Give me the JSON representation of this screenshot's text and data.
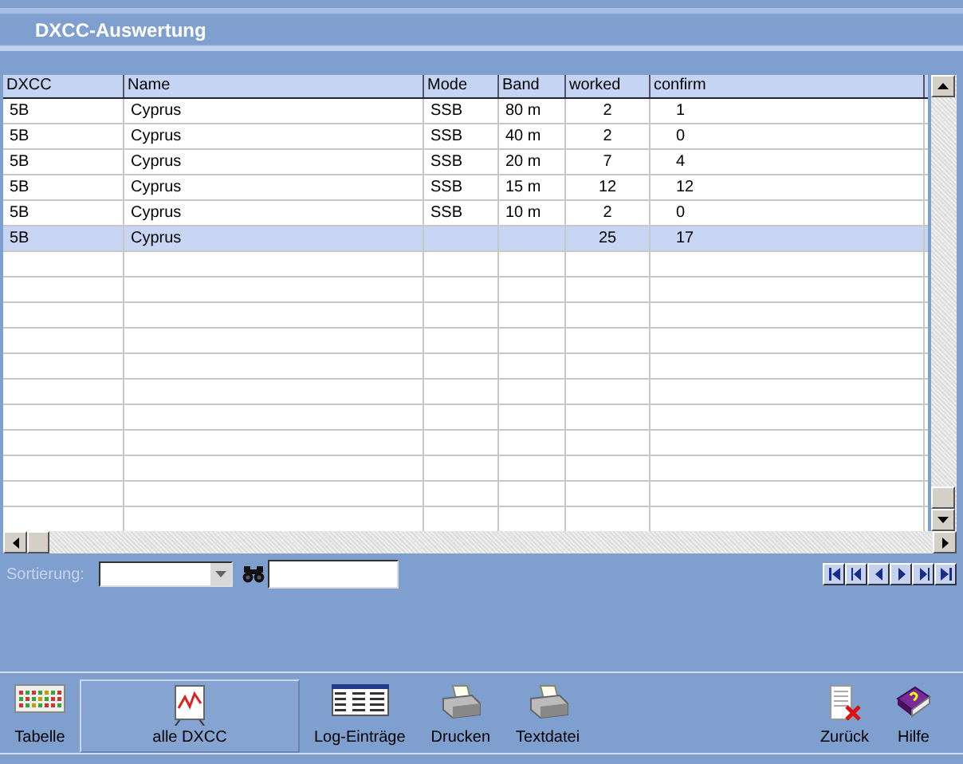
{
  "window": {
    "title": "DXCC-Auswertung"
  },
  "table": {
    "columns": [
      "DXCC",
      "Name",
      "Mode",
      "Band",
      "worked",
      "confirm"
    ],
    "rows": [
      {
        "cells": [
          "5B",
          "Cyprus",
          "SSB",
          "80 m",
          "2",
          "1"
        ],
        "selected": false
      },
      {
        "cells": [
          "5B",
          "Cyprus",
          "SSB",
          "40 m",
          "2",
          "0"
        ],
        "selected": false
      },
      {
        "cells": [
          "5B",
          "Cyprus",
          "SSB",
          "20 m",
          "7",
          "4"
        ],
        "selected": false
      },
      {
        "cells": [
          "5B",
          "Cyprus",
          "SSB",
          "15 m",
          "12",
          "12"
        ],
        "selected": false
      },
      {
        "cells": [
          "5B",
          "Cyprus",
          "SSB",
          "10 m",
          "2",
          "0"
        ],
        "selected": false
      },
      {
        "cells": [
          "5B",
          "Cyprus",
          "",
          "",
          "25",
          "17"
        ],
        "selected": true
      }
    ]
  },
  "sort": {
    "label": "Sortierung:"
  },
  "toolbar": [
    {
      "label": "Tabelle",
      "kind": "table",
      "selected": false
    },
    {
      "label": "alle DXCC",
      "kind": "chart",
      "selected": true
    },
    {
      "label": "Log-Einträge",
      "kind": "log",
      "selected": false
    },
    {
      "label": "Drucken",
      "kind": "print",
      "selected": false
    },
    {
      "label": "Textdatei",
      "kind": "print",
      "selected": false
    },
    {
      "label": "Zurück",
      "kind": "back",
      "selected": false
    },
    {
      "label": "Hilfe",
      "kind": "help",
      "selected": false
    }
  ]
}
